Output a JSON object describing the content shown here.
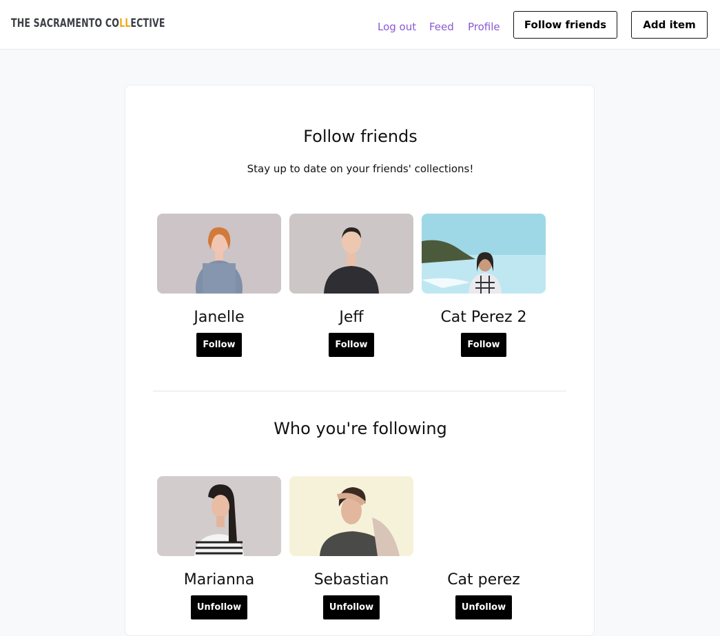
{
  "header": {
    "logo_text_before": "THE SACRAMENTO CO",
    "logo_text_accent": "LL",
    "logo_text_after": "ECTIVE",
    "nav": {
      "logout": "Log out",
      "feed": "Feed",
      "profile": "Profile"
    },
    "follow_friends_button": "Follow friends",
    "add_item_button": "Add item"
  },
  "colors": {
    "accent_purple": "#8a58d6",
    "logo_accent": "#f2a91c",
    "button_black": "#000000"
  },
  "follow_section": {
    "title": "Follow friends",
    "subtitle": "Stay up to date on your friends' collections!",
    "people": [
      {
        "name": "Janelle",
        "action": "Follow"
      },
      {
        "name": "Jeff",
        "action": "Follow"
      },
      {
        "name": "Cat Perez 2",
        "action": "Follow"
      }
    ]
  },
  "following_section": {
    "title": "Who you're following",
    "people": [
      {
        "name": "Marianna",
        "action": "Unfollow"
      },
      {
        "name": "Sebastian",
        "action": "Unfollow"
      },
      {
        "name": "Cat perez",
        "action": "Unfollow"
      }
    ]
  }
}
